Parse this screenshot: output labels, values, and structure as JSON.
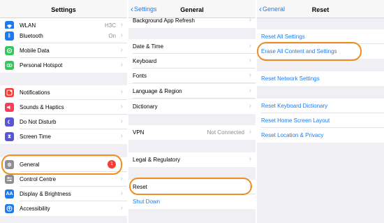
{
  "settings": {
    "title": "Settings",
    "wlan": {
      "label": "WLAN",
      "value": "H3C"
    },
    "bluetooth": {
      "label": "Bluetooth",
      "value": "On"
    },
    "mobile_data": {
      "label": "Mobile Data"
    },
    "hotspot": {
      "label": "Personal Hotspot"
    },
    "notifications": {
      "label": "Notifications"
    },
    "sounds": {
      "label": "Sounds & Haptics"
    },
    "dnd": {
      "label": "Do Not Disturb"
    },
    "screen_time": {
      "label": "Screen Time"
    },
    "general": {
      "label": "General",
      "badge": "1"
    },
    "control_centre": {
      "label": "Control Centre"
    },
    "display": {
      "label": "Display & Brightness",
      "icon_text": "AA"
    },
    "accessibility": {
      "label": "Accessibility"
    }
  },
  "general": {
    "back": "Settings",
    "title": "General",
    "background_refresh": "Background App Refresh",
    "date_time": "Date & Time",
    "keyboard": "Keyboard",
    "fonts": "Fonts",
    "language_region": "Language & Region",
    "dictionary": "Dictionary",
    "vpn": {
      "label": "VPN",
      "value": "Not Connected"
    },
    "legal": "Legal & Regulatory",
    "reset": "Reset",
    "shut_down": "Shut Down"
  },
  "reset": {
    "back": "General",
    "title": "Reset",
    "reset_all_settings": "Reset All Settings",
    "erase_all": "Erase All Content and Settings",
    "reset_network": "Reset Network Settings",
    "reset_keyboard": "Reset Keyboard Dictionary",
    "reset_home": "Reset Home Screen Layout",
    "reset_location": "Reset Location & Privacy"
  },
  "colors": {
    "accent_blue": "#1a7cf5",
    "highlight_orange": "#ef8f22",
    "badge_red": "#fa3b35"
  },
  "icons": [
    "wifi-icon",
    "bluetooth-icon",
    "mobile-data-icon",
    "hotspot-icon",
    "notifications-icon",
    "sounds-icon",
    "moon-icon",
    "hourglass-icon",
    "gear-icon",
    "control-centre-icon",
    "display-icon",
    "accessibility-icon"
  ]
}
